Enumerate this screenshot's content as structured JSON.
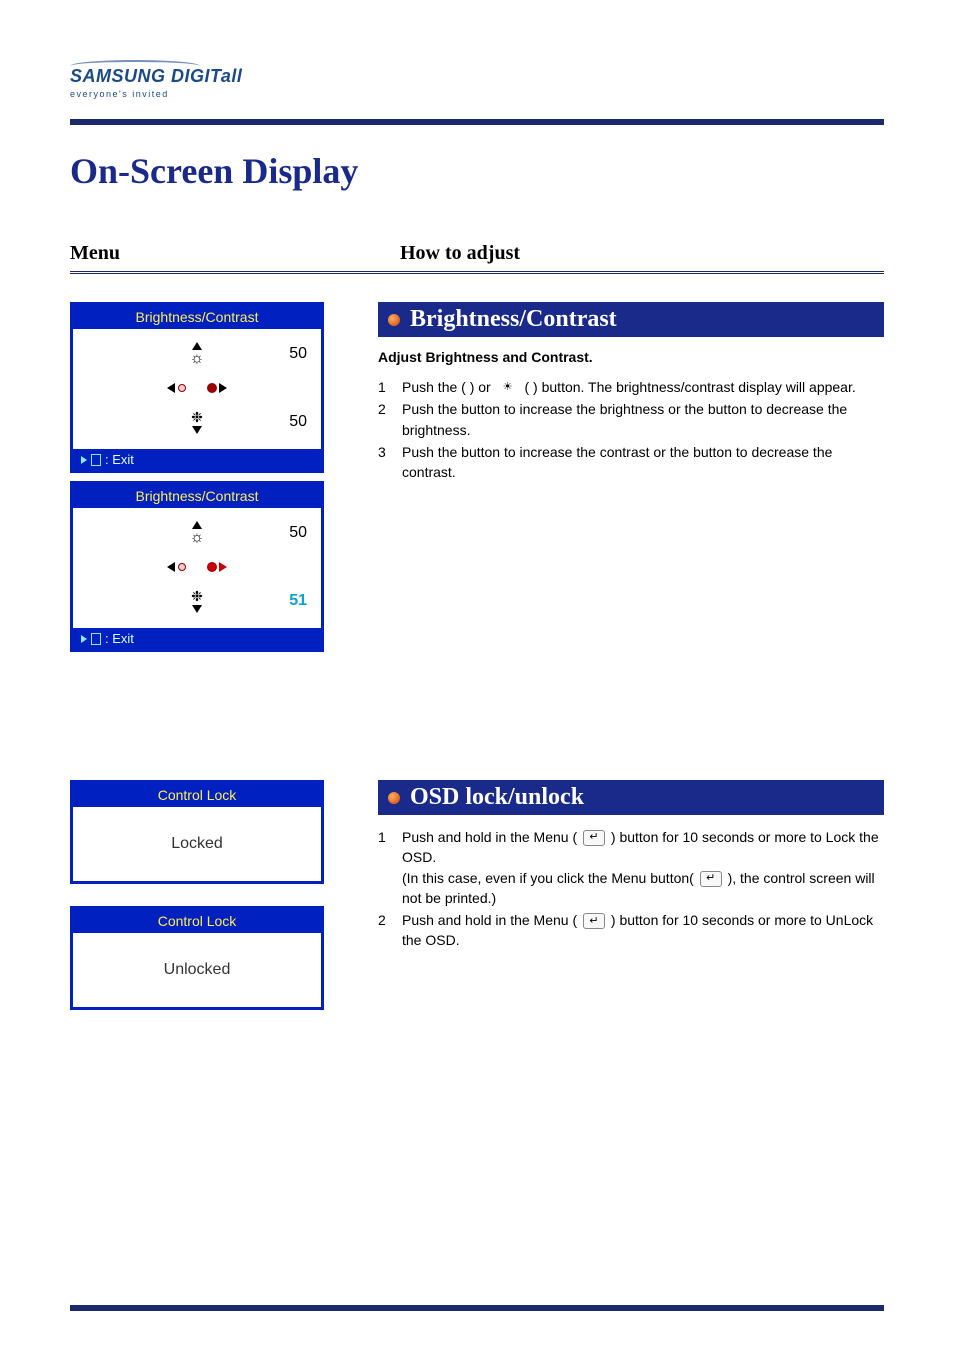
{
  "logo": {
    "brand_main": "SAMSUNG DIGIT",
    "brand_suffix": "all",
    "tagline": "everyone's invited"
  },
  "page_title": "On-Screen Display",
  "column_headers": {
    "menu": "Menu",
    "howto": "How to adjust"
  },
  "osd_panels": {
    "brightness_contrast": {
      "title": "Brightness/Contrast",
      "value_brightness_1": "50",
      "value_contrast_1": "50",
      "value_brightness_2": "50",
      "value_contrast_2": "51",
      "exit_label": ": Exit"
    },
    "control_lock": {
      "title": "Control Lock",
      "locked_label": "Locked",
      "unlocked_label": "Unlocked"
    }
  },
  "sections": {
    "brightness": {
      "heading": "Brightness/Contrast",
      "subheading": "Adjust Brightness and Contrast.",
      "steps": {
        "1": {
          "part_a": "Push the ",
          "part_b": "(      ) or ",
          "part_c": "(       ) button. The brightness/contrast display will appear."
        },
        "2": "Push the     button to increase the brightness or the     button to decrease the brightness.",
        "3": "Push the     button to increase the contrast or the     button to decrease the contrast."
      }
    },
    "osd_lock": {
      "heading": "OSD lock/unlock",
      "steps": {
        "1a": "Push and hold in the Menu ( ",
        "1b": " ) button for 10 seconds or more to Lock the OSD.",
        "1c": "(In this case, even if you click the Menu button( ",
        "1d": " ), the control screen will not be printed.)",
        "2a": "Push and hold in the Menu ( ",
        "2b": " ) button for 10 seconds or more to UnLock the OSD."
      }
    }
  },
  "step_numbers": {
    "n1": "1",
    "n2": "2",
    "n3": "3"
  }
}
